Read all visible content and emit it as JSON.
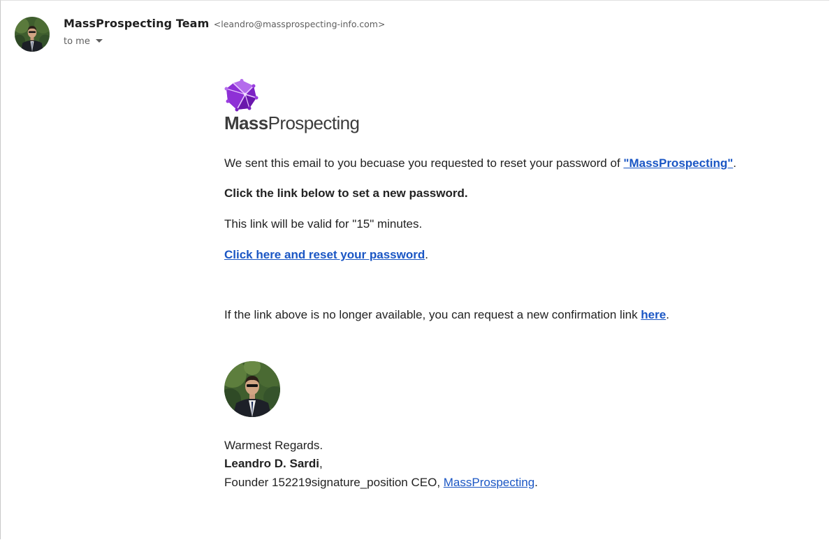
{
  "header": {
    "sender_name": "MassProspecting Team",
    "sender_email": "<leandro@massprospecting-info.com>",
    "recipient_label": "to me"
  },
  "logo": {
    "text_bold": "Mass",
    "text_regular": "Prospecting",
    "colors": {
      "primary": "#8b2fd0",
      "light": "#c48cf0",
      "dark": "#5a1490"
    }
  },
  "body": {
    "line1_text": "We sent this email to you becuase you requested to reset your password of ",
    "line1_link": "\"MassProspecting\"",
    "line1_end": ".",
    "line2": "Click the link below to set a new password.",
    "line3": "This link will be valid for \"15\" minutes.",
    "line4_link": "Click here and reset your password",
    "line4_end": ".",
    "line5_text": "If the link above is no longer available, you can request a new confirmation link ",
    "line5_link": "here",
    "line5_end": "."
  },
  "signature": {
    "greeting": "Warmest Regards.",
    "name": "Leandro D. Sardi",
    "name_end": ",",
    "title_text": "Founder 152219signature_position CEO, ",
    "company_link": "MassProspecting",
    "title_end": "."
  },
  "colors": {
    "link": "#1a56c4",
    "text": "#222222",
    "muted": "#5e5e5e"
  }
}
